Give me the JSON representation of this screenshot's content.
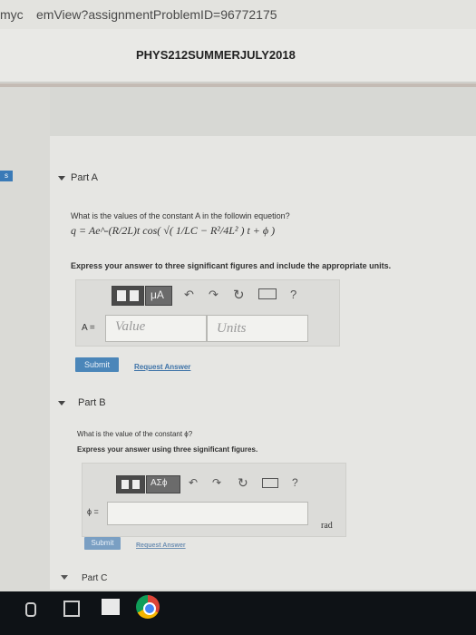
{
  "browser": {
    "url_fragment_left": "myc",
    "url_fragment_right": "emView?assignmentProblemID=96772175"
  },
  "course_title": "PHYS212SUMMERJULY2018",
  "left_tab": "s",
  "partA": {
    "title": "Part A",
    "question": "What is the values of the constant A in the followin equetion?",
    "equation": "q = Ae^-(R/2L)t cos( √( 1/LC − R²/4L² ) t + ϕ )",
    "instruction": "Express your answer to three significant figures and include the appropriate units.",
    "toolbar": {
      "units_label": "μA",
      "help": "?"
    },
    "input_label": "A =",
    "value_placeholder": "Value",
    "units_placeholder": "Units",
    "submit": "Submit",
    "request_answer": "Request Answer"
  },
  "partB": {
    "title": "Part B",
    "question": "What is the value of the constant ϕ?",
    "instruction": "Express your answer using three significant figures.",
    "toolbar": {
      "greek_label": "ΑΣϕ",
      "help": "?"
    },
    "input_label": "ϕ =",
    "unit": "rad",
    "submit": "Submit",
    "request_answer": "Request Answer"
  },
  "partC": {
    "title": "Part C"
  },
  "colors": {
    "accent": "#4b86b9",
    "link": "#3e73a8",
    "taskbar": "#0e1216"
  }
}
